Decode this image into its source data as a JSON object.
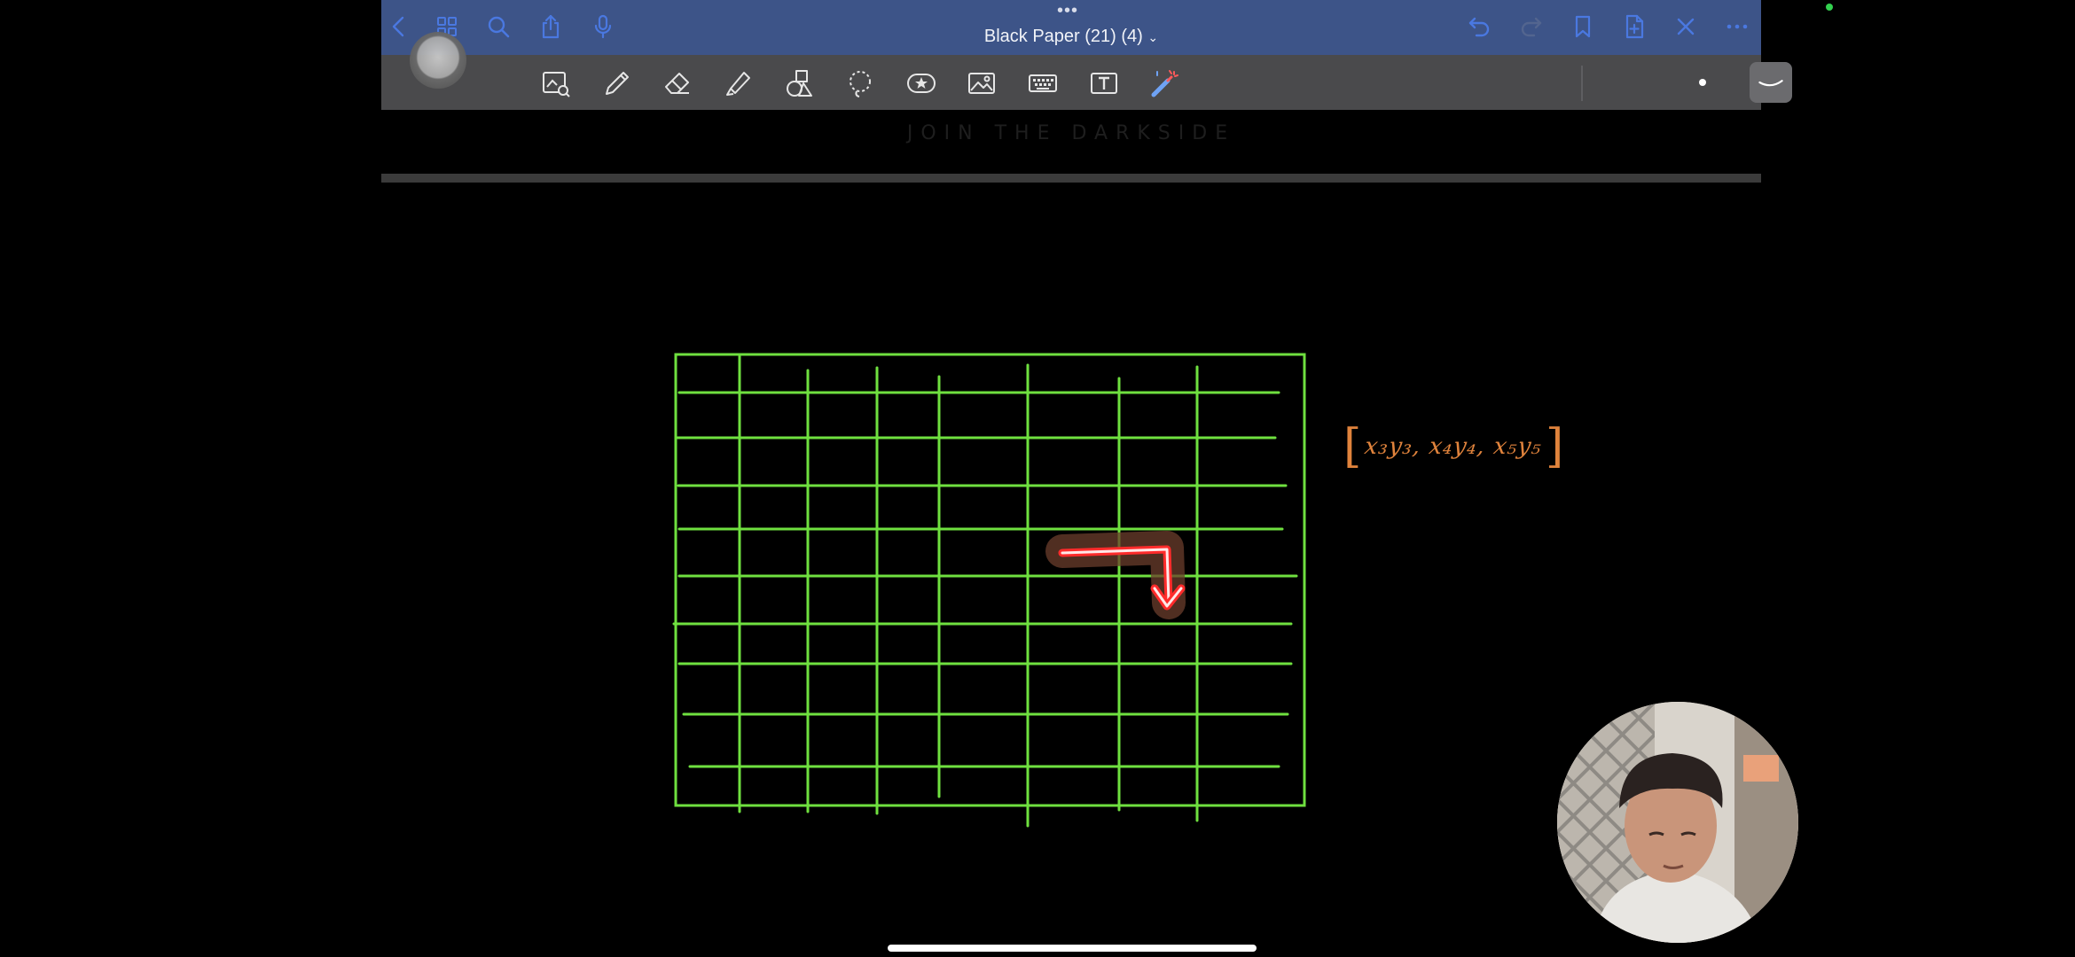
{
  "app": {
    "document_title": "Black Paper (21) (4)",
    "watermark": "JOIN THE DARKSIDE"
  },
  "navbar": {
    "left_icons": [
      "chevron-left-icon",
      "grid-icon",
      "search-icon",
      "share-icon",
      "microphone-icon"
    ],
    "right_icons": [
      "undo-icon",
      "redo-icon",
      "bookmark-icon",
      "add-page-icon",
      "close-icon",
      "more-icon"
    ]
  },
  "toolbar": {
    "tools": [
      "image-zoom-icon",
      "pen-icon",
      "eraser-icon",
      "highlighter-icon",
      "shapes-icon",
      "lasso-icon",
      "sticker-icon",
      "image-icon",
      "keyboard-icon",
      "text-box-icon",
      "laser-pointer-icon"
    ]
  },
  "canvas": {
    "handwriting": "x₃y₃, x₄y₄, x₅y₅",
    "colors": {
      "grid": "#6fe03f",
      "handwriting": "#e0833c",
      "laser": "#ff2b2b",
      "navbar": "#3d5488",
      "toolbar": "#4a4a4c"
    }
  }
}
